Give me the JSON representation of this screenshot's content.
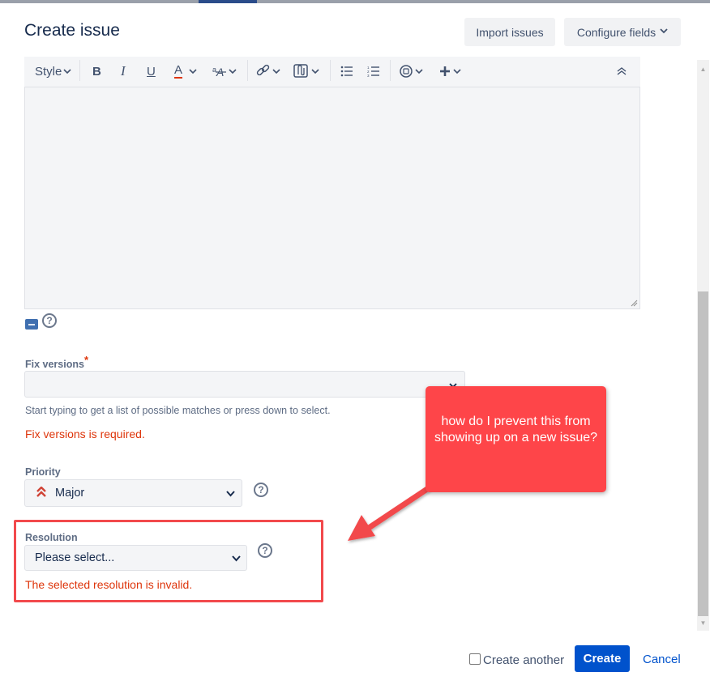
{
  "dialog": {
    "title": "Create issue",
    "import_label": "Import issues",
    "configure_label": "Configure fields"
  },
  "toolbar": {
    "style_label": "Style",
    "bold": "B",
    "italic": "I",
    "underline": "U",
    "text_color": "A"
  },
  "fix_versions": {
    "label": "Fix versions",
    "required_mark": "*",
    "hint": "Start typing to get a list of possible matches or press down to select.",
    "error": "Fix versions is required."
  },
  "priority": {
    "label": "Priority",
    "value": "Major"
  },
  "resolution": {
    "label": "Resolution",
    "value": "Please select...",
    "error": "The selected resolution is invalid."
  },
  "annotation": {
    "text": "how do I prevent this from showing up on a new issue?"
  },
  "footer": {
    "create_another_label": "Create another",
    "create_label": "Create",
    "cancel_label": "Cancel"
  },
  "colors": {
    "primary": "#0052cc",
    "error": "#de350b",
    "callout": "#fe4549",
    "priority_major": "#d04437"
  },
  "icons": [
    "chevron-down-icon",
    "help-icon",
    "folder-icon",
    "link-icon",
    "attachment-icon",
    "bullet-list-icon",
    "numbered-list-icon",
    "emoji-icon",
    "plus-icon",
    "collapse-icon",
    "priority-major-icon"
  ]
}
